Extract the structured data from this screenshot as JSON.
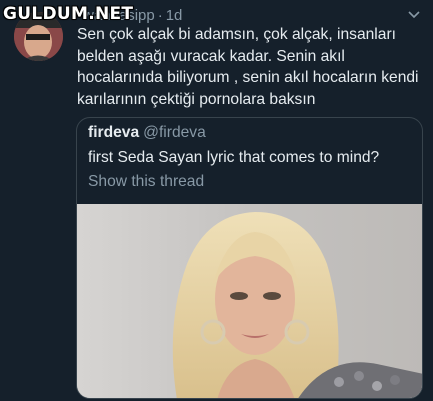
{
  "watermark": {
    "text": "GULDUM.NET"
  },
  "tweet": {
    "handle_partial": "wannasipp",
    "separator": "·",
    "time": "1d",
    "text": "Sen çok alçak bi adamsın, çok alçak, insanları belden aşağı vuracak kadar. Senin akıl hocalarınıda biliyorum , senin akıl hocaların kendi karılarının çektiği pornolara baksın",
    "menu_icon": "chevron-down-icon"
  },
  "quote": {
    "name": "firdeva",
    "handle": "@firdeva",
    "text": "first Seda Sayan lyric that comes to mind?",
    "show_thread": "Show this thread"
  },
  "colors": {
    "background": "#15202b",
    "text": "#e6ecf0",
    "muted": "#8899a6",
    "border": "#38444d"
  }
}
